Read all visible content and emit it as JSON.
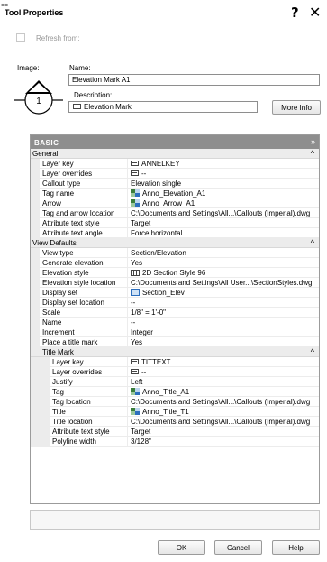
{
  "window": {
    "title": "Tool Properties",
    "help_glyph": "?",
    "close_glyph": "✕"
  },
  "refresh": {
    "label": "Refresh from:"
  },
  "image": {
    "label": "Image:",
    "number": "1"
  },
  "name_field": {
    "label": "Name:",
    "value": "Elevation Mark A1"
  },
  "description_field": {
    "label": "Description:",
    "value": "Elevation Mark",
    "more_info_label": "More Info"
  },
  "grid": {
    "header": "BASIC",
    "header_chevron": "»",
    "collapse_glyph": "^",
    "general": {
      "label": "General",
      "rows": [
        {
          "name": "Layer key",
          "value": "ANNELKEY",
          "icon": "layer-icon"
        },
        {
          "name": "Layer overrides",
          "value": "--",
          "icon": "layer-icon"
        },
        {
          "name": "Callout type",
          "value": "Elevation single",
          "icon": ""
        },
        {
          "name": "Tag name",
          "value": "Anno_Elevation_A1",
          "icon": "tag-icon"
        },
        {
          "name": "Arrow",
          "value": "Anno_Arrow_A1",
          "icon": "tag-icon"
        },
        {
          "name": "Tag and arrow location",
          "value": "C:\\Documents and Settings\\All...\\Callouts (Imperial).dwg",
          "icon": ""
        },
        {
          "name": "Attribute text style",
          "value": "Target",
          "icon": ""
        },
        {
          "name": "Attribute text angle",
          "value": "Force horizontal",
          "icon": ""
        }
      ]
    },
    "view_defaults": {
      "label": "View Defaults",
      "rows": [
        {
          "name": "View type",
          "value": "Section/Elevation",
          "icon": ""
        },
        {
          "name": "Generate elevation",
          "value": "Yes",
          "icon": ""
        },
        {
          "name": "Elevation style",
          "value": "2D Section Style 96",
          "icon": "style-icon"
        },
        {
          "name": "Elevation style location",
          "value": "C:\\Documents and Settings\\All User...\\SectionStyles.dwg",
          "icon": ""
        },
        {
          "name": "Display set",
          "value": "Section_Elev",
          "icon": "display-set-icon"
        },
        {
          "name": "Display set location",
          "value": "--",
          "icon": ""
        },
        {
          "name": "Scale",
          "value": "1/8\" = 1'-0\"",
          "icon": ""
        },
        {
          "name": "Name",
          "value": "--",
          "icon": ""
        },
        {
          "name": "Increment",
          "value": "Integer",
          "icon": ""
        },
        {
          "name": "Place a title mark",
          "value": "Yes",
          "icon": ""
        }
      ]
    },
    "title_mark": {
      "label": "Title Mark",
      "rows": [
        {
          "name": "Layer key",
          "value": "TITTEXT",
          "icon": "layer-icon"
        },
        {
          "name": "Layer overrides",
          "value": "--",
          "icon": "layer-icon"
        },
        {
          "name": "Justify",
          "value": "Left",
          "icon": ""
        },
        {
          "name": "Tag",
          "value": "Anno_Title_A1",
          "icon": "tag-icon"
        },
        {
          "name": "Tag location",
          "value": "C:\\Documents and Settings\\All...\\Callouts (Imperial).dwg",
          "icon": ""
        },
        {
          "name": "Title",
          "value": "Anno_Title_T1",
          "icon": "tag-icon"
        },
        {
          "name": "Title location",
          "value": "C:\\Documents and Settings\\All...\\Callouts (Imperial).dwg",
          "icon": ""
        },
        {
          "name": "Attribute text style",
          "value": "Target",
          "icon": ""
        },
        {
          "name": "Polyline width",
          "value": "3/128\"",
          "icon": ""
        }
      ]
    }
  },
  "buttons": {
    "ok": "OK",
    "cancel": "Cancel",
    "help": "Help"
  }
}
